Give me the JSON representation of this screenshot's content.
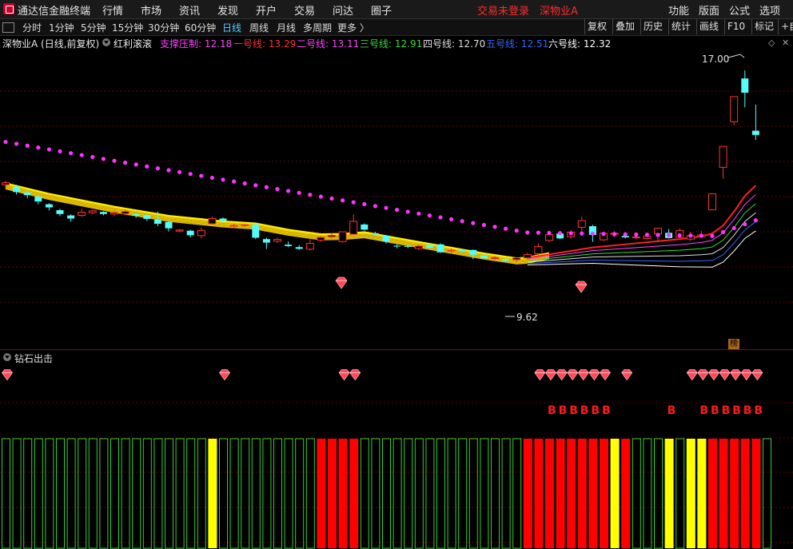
{
  "menubar": {
    "app_title": "通达信金融终端",
    "items": [
      "行情",
      "市场",
      "资讯",
      "发现",
      "开户",
      "交易",
      "问达",
      "圈子"
    ],
    "status_login": "交易未登录",
    "status_stock": "深物业A",
    "right_items": [
      "功能",
      "版面",
      "公式",
      "选项"
    ]
  },
  "tabbar": {
    "periods": [
      "分时",
      "1分钟",
      "5分钟",
      "15分钟",
      "30分钟",
      "60分钟",
      "日线",
      "周线",
      "月线",
      "多周期",
      "更多 〉"
    ],
    "active": "日线",
    "right_buttons": [
      "复权",
      "叠加",
      "历史",
      "统计",
      "画线",
      "F10",
      "标记",
      "+自"
    ]
  },
  "infobar": {
    "title": "深物业A (日线,前复权)",
    "indicator_name": "红利滚滚",
    "lines": [
      {
        "label": "支撑压制:",
        "value": "12.18",
        "color": "#ff44ff"
      },
      {
        "label": "一号线:",
        "value": "13.29",
        "color": "#ff3030"
      },
      {
        "label": "二号线:",
        "value": "13.11",
        "color": "#ff44ff"
      },
      {
        "label": "三号线:",
        "value": "12.91",
        "color": "#33dd33"
      },
      {
        "label": "四号线:",
        "value": "12.70",
        "color": "#dddddd"
      },
      {
        "label": "五号线:",
        "value": "12.51",
        "color": "#3366ff"
      },
      {
        "label": "六号线:",
        "value": "12.32",
        "color": "#ffffff"
      }
    ]
  },
  "main_chart": {
    "high_label": "17.00",
    "low_label": "9.62",
    "badge": "榜"
  },
  "sub_chart": {
    "title": "钻石出击",
    "signal_letter": "B",
    "colors": {
      "green": "#33cc33",
      "yellow": "#ffff00",
      "red": "#ff0000"
    },
    "bars": [
      "g",
      "g",
      "g",
      "g",
      "g",
      "g",
      "g",
      "g",
      "g",
      "g",
      "g",
      "g",
      "g",
      "g",
      "g",
      "g",
      "g",
      "g",
      "g",
      "y",
      "g",
      "g",
      "g",
      "g",
      "g",
      "g",
      "g",
      "g",
      "g",
      "r",
      "r",
      "r",
      "r",
      "g",
      "g",
      "g",
      "g",
      "g",
      "g",
      "g",
      "g",
      "g",
      "g",
      "g",
      "g",
      "g",
      "g",
      "g",
      "r",
      "r",
      "r",
      "r",
      "r",
      "r",
      "r",
      "r",
      "y",
      "r",
      "g",
      "g",
      "g",
      "y",
      "g",
      "y",
      "y",
      "r",
      "r",
      "r",
      "r",
      "r",
      "g"
    ],
    "diamond_idx": [
      0,
      20,
      31,
      32,
      49,
      50,
      51,
      52,
      53,
      54,
      55,
      57,
      63,
      64,
      65,
      66,
      67,
      68,
      69
    ],
    "b_idx": [
      50,
      51,
      52,
      53,
      54,
      55,
      61,
      64,
      65,
      66,
      67,
      68,
      69
    ]
  },
  "chart_data": {
    "type": "candlestick",
    "candles": [
      [
        13.72,
        13.78,
        13.6,
        13.84
      ],
      [
        13.66,
        13.51,
        13.44,
        13.72
      ],
      [
        13.5,
        13.42,
        13.33,
        13.55
      ],
      [
        13.38,
        13.24,
        13.16,
        13.42
      ],
      [
        13.16,
        13.07,
        12.98,
        13.19
      ],
      [
        12.99,
        12.88,
        12.82,
        13.03
      ],
      [
        12.84,
        12.75,
        12.66,
        12.87
      ],
      [
        12.84,
        12.93,
        12.8,
        13.03
      ],
      [
        12.92,
        12.97,
        12.87,
        13.0
      ],
      [
        12.94,
        12.88,
        12.84,
        12.96
      ],
      [
        12.88,
        12.92,
        12.82,
        12.98
      ],
      [
        12.89,
        12.95,
        12.85,
        13.02
      ],
      [
        12.88,
        12.83,
        12.77,
        12.9
      ],
      [
        12.85,
        12.74,
        12.68,
        12.88
      ],
      [
        12.72,
        12.6,
        12.53,
        12.95
      ],
      [
        12.65,
        12.47,
        12.38,
        12.7
      ],
      [
        12.39,
        12.42,
        12.36,
        12.45
      ],
      [
        12.4,
        12.27,
        12.21,
        12.43
      ],
      [
        12.26,
        12.41,
        12.18,
        12.49
      ],
      [
        12.6,
        12.75,
        12.58,
        12.81
      ],
      [
        12.75,
        12.68,
        12.63,
        12.78
      ],
      [
        12.54,
        12.55,
        12.49,
        12.6
      ],
      [
        12.56,
        12.57,
        12.52,
        12.6
      ],
      [
        12.58,
        12.2,
        12.16,
        12.61
      ],
      [
        12.16,
        12.06,
        11.88,
        12.2
      ],
      [
        12.1,
        12.15,
        12.05,
        12.2
      ],
      [
        12.0,
        11.96,
        11.93,
        12.09
      ],
      [
        11.93,
        11.88,
        11.85,
        11.99
      ],
      [
        11.87,
        12.04,
        11.83,
        12.15
      ],
      [
        12.13,
        12.21,
        12.08,
        12.25
      ],
      [
        12.23,
        12.27,
        12.18,
        12.33
      ],
      [
        12.09,
        12.37,
        12.06,
        12.37
      ],
      [
        12.3,
        12.67,
        12.31,
        12.87
      ],
      [
        12.58,
        12.43,
        12.41,
        12.61
      ],
      [
        12.33,
        12.29,
        12.27,
        12.37
      ],
      [
        12.26,
        12.09,
        12.03,
        12.28
      ],
      [
        11.97,
        11.95,
        11.9,
        12.01
      ],
      [
        11.96,
        11.95,
        11.9,
        12.01
      ],
      [
        11.89,
        11.96,
        11.84,
        11.99
      ],
      [
        11.99,
        11.91,
        11.87,
        12.03
      ],
      [
        12.01,
        11.78,
        11.77,
        12.04
      ],
      [
        11.82,
        11.84,
        11.76,
        11.89
      ],
      [
        11.86,
        11.81,
        11.79,
        11.87
      ],
      [
        11.85,
        11.71,
        11.58,
        11.86
      ],
      [
        11.69,
        11.61,
        11.6,
        11.73
      ],
      [
        11.6,
        11.63,
        11.56,
        11.67
      ],
      [
        11.59,
        11.54,
        11.49,
        11.61
      ],
      [
        11.57,
        11.62,
        11.5,
        11.64
      ],
      [
        11.62,
        11.72,
        11.57,
        11.77
      ],
      [
        11.74,
        11.95,
        11.67,
        12.04
      ],
      [
        12.12,
        12.29,
        12.08,
        12.32
      ],
      [
        12.32,
        12.18,
        12.16,
        12.35
      ],
      [
        12.23,
        12.36,
        12.17,
        12.42
      ],
      [
        12.5,
        12.69,
        12.31,
        12.81
      ],
      [
        12.53,
        12.28,
        12.08,
        12.57
      ],
      [
        12.14,
        12.33,
        12.1,
        12.36
      ],
      [
        12.3,
        12.33,
        12.22,
        12.39
      ],
      [
        12.25,
        12.21,
        12.18,
        12.3
      ],
      [
        12.2,
        12.22,
        12.17,
        12.24
      ],
      [
        12.18,
        12.24,
        12.14,
        12.31
      ],
      [
        12.31,
        12.47,
        12.08,
        12.49
      ],
      [
        12.34,
        12.19,
        12.18,
        12.45
      ],
      [
        12.21,
        12.41,
        12.19,
        12.47
      ],
      [
        12.16,
        12.26,
        12.1,
        12.37
      ],
      [
        12.23,
        12.28,
        12.2,
        12.39
      ],
      [
        13.0,
        13.46,
        12.99,
        13.48
      ],
      [
        14.22,
        14.82,
        13.89,
        14.83
      ],
      [
        15.53,
        16.25,
        15.43,
        16.26
      ],
      [
        16.77,
        16.36,
        15.94,
        17.0
      ],
      [
        15.27,
        15.15,
        15.01,
        16.02
      ]
    ]
  }
}
